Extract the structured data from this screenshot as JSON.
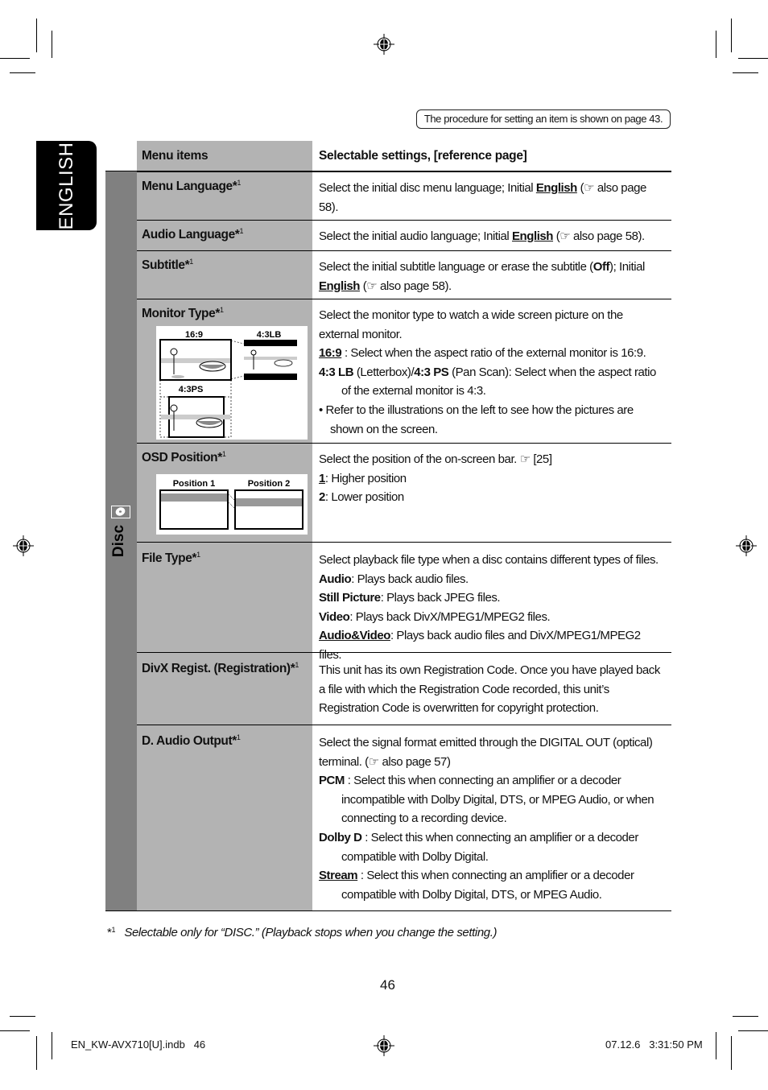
{
  "note": "The procedure for setting an item is shown on page 43.",
  "language_tab": "ENGLISH",
  "section": {
    "label": "Disc",
    "icon": "disc-icon"
  },
  "table": {
    "headers": {
      "left": "Menu items",
      "right": "Selectable settings, [reference page]"
    },
    "rows": [
      {
        "item": "Menu Language*",
        "sup": "1",
        "lines": [
          {
            "parts": [
              {
                "t": "Select the initial disc menu language; Initial "
              },
              {
                "t": "English",
                "b": true,
                "u": true
              },
              {
                "t": " (☞ also page 58)."
              }
            ]
          }
        ]
      },
      {
        "item": "Audio Language*",
        "sup": "1",
        "lines": [
          {
            "parts": [
              {
                "t": "Select the initial audio language; Initial "
              },
              {
                "t": "English",
                "b": true,
                "u": true
              },
              {
                "t": " (☞ also page 58)."
              }
            ]
          }
        ]
      },
      {
        "item": "Subtitle*",
        "sup": "1",
        "lines": [
          {
            "parts": [
              {
                "t": "Select the initial subtitle language or erase the subtitle ("
              },
              {
                "t": "Off",
                "b": true
              },
              {
                "t": "); Initial "
              },
              {
                "t": "English",
                "b": true,
                "u": true
              },
              {
                "t": " (☞ also page 58)."
              }
            ]
          }
        ]
      },
      {
        "item": "Monitor Type*",
        "sup": "1",
        "illustration": {
          "labels": [
            "16:9",
            "4:3LB",
            "4:3PS"
          ]
        },
        "lines": [
          {
            "parts": [
              {
                "t": "Select the monitor type to watch a wide screen picture on the external monitor."
              }
            ]
          },
          {
            "parts": [
              {
                "t": "16:9",
                "b": true,
                "u": true
              },
              {
                "t": " : Select when the aspect ratio of the external monitor is 16:9."
              }
            ]
          },
          {
            "hang": true,
            "parts": [
              {
                "t": "4:3 LB",
                "b": true
              },
              {
                "t": " (Letterbox)/"
              },
              {
                "t": "4:3 PS",
                "b": true
              },
              {
                "t": " (Pan Scan): Select when the aspect ratio of the external monitor is 4:3."
              }
            ]
          },
          {
            "bullet": true,
            "parts": [
              {
                "t": "•  Refer to the illustrations on the left to see how the pictures are shown on the screen."
              }
            ]
          }
        ]
      },
      {
        "item": "OSD Position*",
        "sup": "1",
        "illustration": {
          "labels": [
            "Position 1",
            "Position 2"
          ]
        },
        "lines": [
          {
            "parts": [
              {
                "t": "Select the position of the on-screen bar. ☞ [25]"
              }
            ]
          },
          {
            "parts": [
              {
                "t": "1",
                "b": true,
                "u": true
              },
              {
                "t": ": Higher position"
              }
            ]
          },
          {
            "parts": [
              {
                "t": "2",
                "b": true
              },
              {
                "t": ": Lower position"
              }
            ]
          }
        ]
      },
      {
        "item": "File Type*",
        "sup": "1",
        "lines": [
          {
            "parts": [
              {
                "t": "Select playback file type when a disc contains different types of files."
              }
            ]
          },
          {
            "parts": [
              {
                "t": "Audio",
                "b": true
              },
              {
                "t": ": Plays back audio files."
              }
            ]
          },
          {
            "parts": [
              {
                "t": "Still Picture",
                "b": true
              },
              {
                "t": ": Plays back JPEG files."
              }
            ]
          },
          {
            "parts": [
              {
                "t": "Video",
                "b": true
              },
              {
                "t": ": Plays back DivX/MPEG1/MPEG2 files."
              }
            ]
          },
          {
            "parts": [
              {
                "t": "Audio&Video",
                "b": true,
                "u": true
              },
              {
                "t": ": Plays back audio files and DivX/MPEG1/MPEG2 files."
              }
            ]
          }
        ]
      },
      {
        "item": "DivX Regist. (Registration)*",
        "sup": "1",
        "lines": [
          {
            "parts": [
              {
                "t": "This unit has its own Registration Code. Once you have played back a file with which the Registration Code recorded, this unit’s Registration Code is overwritten for copyright protection."
              }
            ]
          }
        ]
      },
      {
        "item": "D. Audio Output*",
        "sup": "1",
        "lines": [
          {
            "parts": [
              {
                "t": "Select the signal format emitted through the DIGITAL OUT (optical) terminal. (☞ also page 57)"
              }
            ]
          },
          {
            "hang": true,
            "parts": [
              {
                "t": "PCM",
                "b": true
              },
              {
                "t": " : Select this when connecting an amplifier or a decoder incompatible with Dolby Digital, DTS, or MPEG Audio, or when connecting to a recording device."
              }
            ]
          },
          {
            "hang": true,
            "parts": [
              {
                "t": "Dolby D",
                "b": true
              },
              {
                "t": " : Select this when connecting an amplifier or a decoder compatible with Dolby Digital."
              }
            ]
          },
          {
            "hang": true,
            "parts": [
              {
                "t": "Stream",
                "b": true,
                "u": true
              },
              {
                "t": " : Select this when connecting an amplifier or a decoder compatible with Dolby Digital, DTS, or MPEG Audio."
              }
            ]
          }
        ]
      }
    ]
  },
  "footnote": {
    "mark": "*",
    "sup": "1",
    "text": "Selectable only for “DISC.” (Playback stops when you change the setting.)"
  },
  "page_number": "46",
  "slug": {
    "file": "EN_KW-AVX710[U].indb   46",
    "timestamp": "07.12.6   3:31:50 PM"
  }
}
